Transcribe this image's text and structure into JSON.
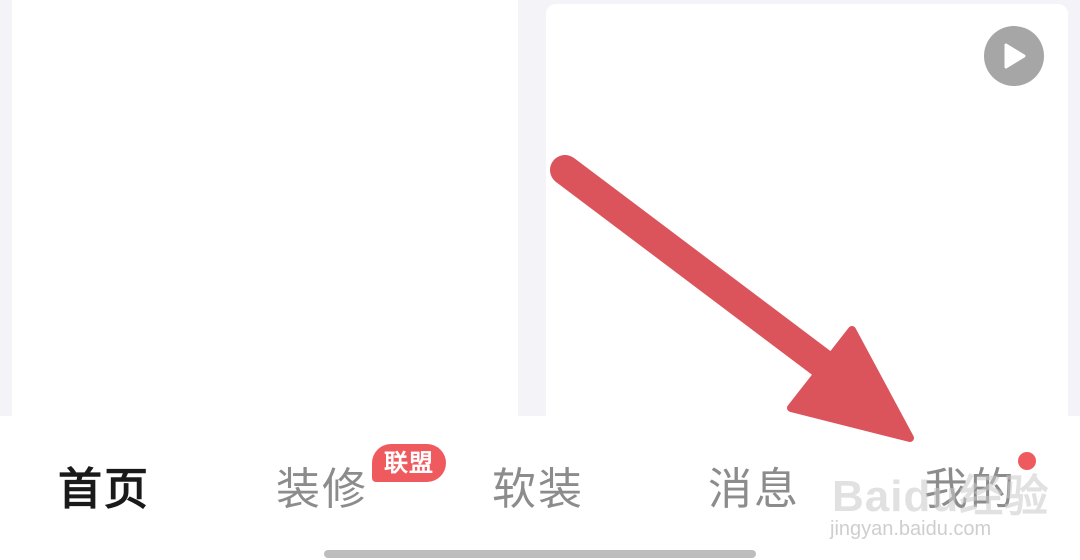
{
  "tabbar": {
    "tabs": [
      {
        "label": "首页",
        "active": true
      },
      {
        "label": "装修",
        "active": false,
        "badge": "联盟"
      },
      {
        "label": "软装",
        "active": false
      },
      {
        "label": "消息",
        "active": false
      },
      {
        "label": "我的",
        "active": false,
        "dot": true
      }
    ]
  },
  "content": {
    "video_icon": "play-icon"
  },
  "watermark": {
    "logo": "Baidu经验",
    "url": "jingyan.baidu.com"
  },
  "colors": {
    "accent": "#ef5a5f",
    "arrow": "#dc545b",
    "active_tab": "#1a1a1a",
    "inactive_tab": "#8c8c8c"
  }
}
